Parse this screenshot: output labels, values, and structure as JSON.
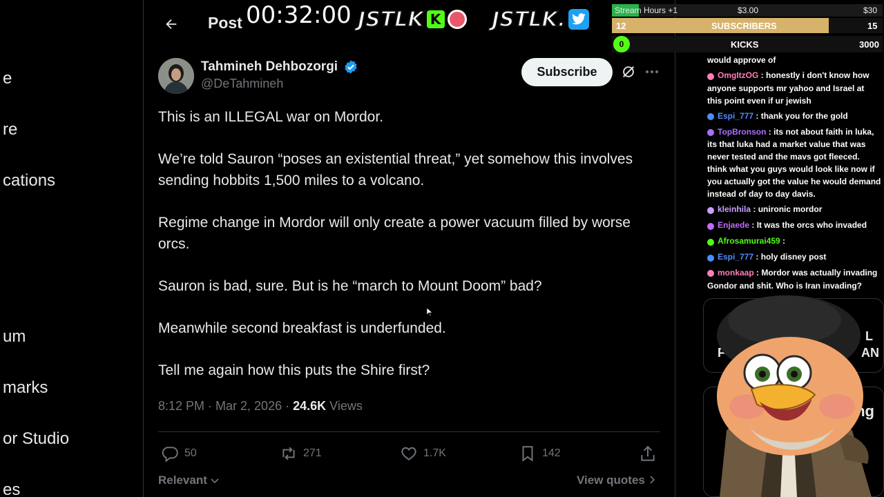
{
  "sidebar": {
    "items": [
      {
        "label": "e"
      },
      {
        "label": "re"
      },
      {
        "label": "cations"
      },
      {
        "label": "um"
      },
      {
        "label": "marks"
      },
      {
        "label": "or Studio"
      },
      {
        "label": "es"
      }
    ]
  },
  "header": {
    "title": "Post"
  },
  "overlay": {
    "timer": "00:32:00",
    "logo_text_1": "JSTLK",
    "kick_letter": "K",
    "logo_text_2": "JSTLK."
  },
  "stream_stats": {
    "hours_label": "Stream Hours +1",
    "hours_amount": "$3.00",
    "hours_goal": "$30",
    "hours_progress": 0.1,
    "subs_current": "12",
    "subs_label": "SUBSCRIBERS",
    "subs_goal": "15",
    "subs_progress": 0.8,
    "kicks_current": "0",
    "kicks_label": "KICKS",
    "kicks_goal": "3000"
  },
  "post": {
    "author_name": "Tahmineh Dehbozorgi",
    "handle": "@DeTahmineh",
    "subscribe_label": "Subscribe",
    "paragraphs": [
      "This is an ILLEGAL war on Mordor.",
      "We’re told Sauron “poses an existential threat,” yet somehow this involves sending hobbits 1,500 miles to a volcano.",
      "Regime change in Mordor will only create a power vacuum filled by worse orcs.",
      "Sauron is bad, sure. But is he “march to Mount Doom” bad?",
      "Meanwhile second breakfast is underfunded.",
      "Tell me again how this puts the Shire first?"
    ],
    "timestamp": "8:12 PM · Mar 2, 2026 · ",
    "views_count": "24.6K",
    "views_label": " Views",
    "actions": {
      "replies": "50",
      "reposts": "271",
      "likes": "1.7K",
      "bookmarks": "142"
    },
    "sort_label": "Relevant",
    "view_quotes_label": "View quotes"
  },
  "chat": {
    "messages": [
      {
        "user": "",
        "text": "would approve of",
        "color": "#ffffff"
      },
      {
        "user": "OmgItzOG",
        "text": " : honestly i don't know how anyone supports mr yahoo and Israel at this point even if ur jewish",
        "color": "#ff7eb6"
      },
      {
        "user": "Espi_777",
        "text": " : thank you for the gold",
        "color": "#4f8cff"
      },
      {
        "user": "TopBronson",
        "text": " : its not about faith in luka, its that luka had a market value that was never tested and the mavs got fleeced. think what you guys would look like now if you actually got the value he would demand instead of day to day davis.",
        "color": "#a970ff"
      },
      {
        "user": "kleinhila",
        "text": " : unironic mordor",
        "color": "#c9a0ff"
      },
      {
        "user": "Enjaede",
        "text": " : It was the orcs who invaded",
        "color": "#c06bff"
      },
      {
        "user": "Afrosamurai459",
        "text": " : ",
        "color": "#53fc18"
      },
      {
        "user": "Espi_777",
        "text": " : holy disney post",
        "color": "#4f8cff"
      },
      {
        "user": "monkaap",
        "text": " : Mordor was actually invading Gondor and shit. Who is Iran invading?",
        "color": "#ff7eb6"
      }
    ]
  },
  "widgets": {
    "card1_left": "F",
    "card1_right": "AN",
    "card1_right_top": "L",
    "card2_text": "ing"
  },
  "colors": {
    "background": "#000000",
    "text_primary": "#e7e9ea",
    "text_secondary": "#71767b",
    "divider": "#2f3336",
    "verified_blue": "#1d9bf0",
    "kick_green": "#53fc18"
  }
}
